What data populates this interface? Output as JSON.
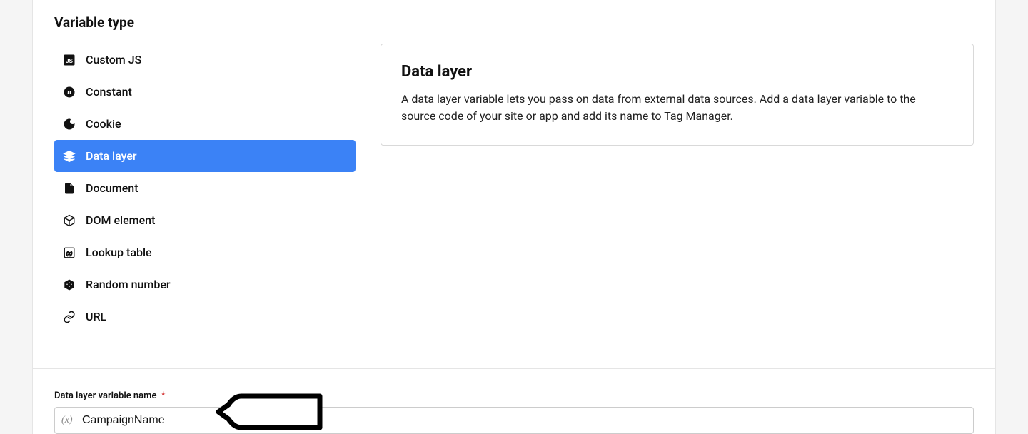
{
  "section": {
    "title": "Variable type"
  },
  "types": [
    {
      "id": "custom-js",
      "label": "Custom JS"
    },
    {
      "id": "constant",
      "label": "Constant"
    },
    {
      "id": "cookie",
      "label": "Cookie"
    },
    {
      "id": "data-layer",
      "label": "Data layer",
      "active": true
    },
    {
      "id": "document",
      "label": "Document"
    },
    {
      "id": "dom-element",
      "label": "DOM element"
    },
    {
      "id": "lookup-table",
      "label": "Lookup table"
    },
    {
      "id": "random-number",
      "label": "Random number"
    },
    {
      "id": "url",
      "label": "URL"
    }
  ],
  "info": {
    "title": "Data layer",
    "description": "A data layer variable lets you pass on data from external data sources. Add a data layer variable to the source code of your site or app and add its name to Tag Manager."
  },
  "field": {
    "label": "Data layer variable name",
    "required_mark": "*",
    "value": "CampaignName",
    "prefix": "(x)"
  }
}
